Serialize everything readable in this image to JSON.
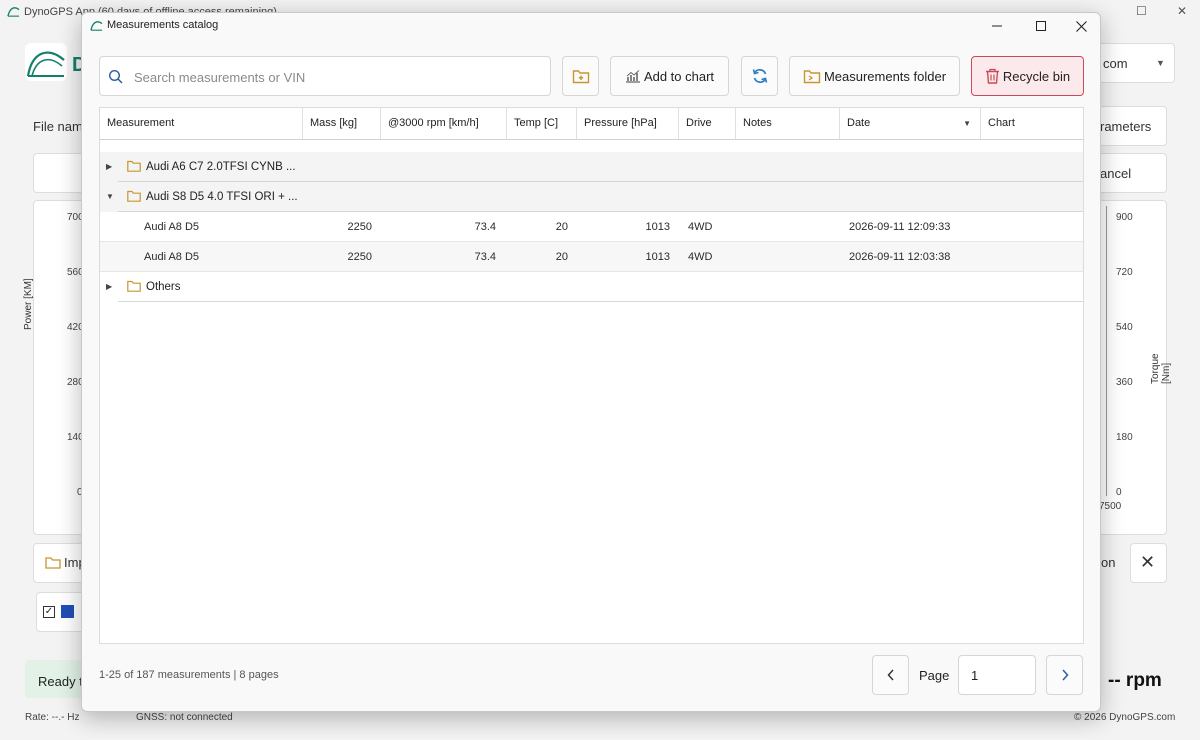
{
  "app": {
    "title": "DynoGPS App (60 days of offline access remaining)",
    "logo_letter": "D",
    "file_label": "File nam",
    "right_combo_partial": "com",
    "params_partial": "rameters",
    "cancel_partial": "ancel",
    "left_axis_title": "Power [KM]",
    "right_axis_title": "Torque [Nm]",
    "left_ticks": [
      "700",
      "560",
      "420",
      "280",
      "140",
      "0"
    ],
    "right_ticks": [
      "900",
      "720",
      "540",
      "360",
      "180",
      "0"
    ],
    "x_tick_end": "7500",
    "import_partial": "Imp",
    "on_partial": "on",
    "ready_partial": "Ready to",
    "rpm": "-- rpm",
    "rate": "Rate: --.- Hz",
    "gnss": "GNSS: not connected",
    "copyright": "© 2026 DynoGPS.com"
  },
  "dialog": {
    "title": "Measurements catalog",
    "search_placeholder": "Search measurements or VIN",
    "search_value": "",
    "add_to_chart_label": "Add to chart",
    "measurements_folder_label": "Measurements folder",
    "recycle_bin_label": "Recycle bin",
    "columns": [
      "Measurement",
      "Mass [kg]",
      "@3000 rpm [km/h]",
      "Temp [C]",
      "Pressure [hPa]",
      "Drive",
      "Notes",
      "Date",
      "Chart"
    ],
    "groups": [
      {
        "label": "Audi A6 C7 2.0TFSI CYNB ...",
        "expanded": false
      },
      {
        "label": "Audi S8 D5 4.0 TFSI ORI + ...",
        "expanded": true
      },
      {
        "label": "Others",
        "expanded": false
      }
    ],
    "rows": [
      {
        "measurement": "Audi A8 D5",
        "mass": "2250",
        "speed": "73.4",
        "temp": "20",
        "pressure": "1013",
        "drive": "4WD",
        "notes": "",
        "date": "2026-09-11 12:09:33",
        "chart": ""
      },
      {
        "measurement": "Audi A8 D5",
        "mass": "2250",
        "speed": "73.4",
        "temp": "20",
        "pressure": "1013",
        "drive": "4WD",
        "notes": "",
        "date": "2026-09-11 12:03:38",
        "chart": ""
      }
    ],
    "footer_summary": "1-25 of 187 measurements | 8 pages",
    "page_label": "Page",
    "page_value": "1",
    "colors": {
      "accent_green": "#14806a",
      "folder": "#c8962e",
      "recycle_border": "#c94a5a",
      "recycle_bg": "#fbe9ec",
      "refresh_blue": "#2a7fc4"
    }
  }
}
